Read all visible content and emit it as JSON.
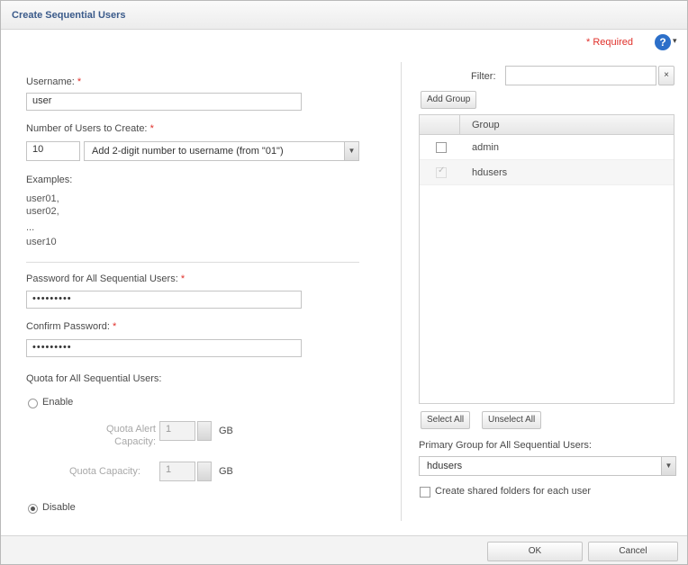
{
  "window": {
    "title": "Create Sequential Users"
  },
  "header": {
    "required_label": "* Required",
    "help_icon": "?",
    "help_caret": "▾"
  },
  "left": {
    "username_label": "Username:",
    "username_value": "user",
    "count_label": "Number of Users to Create:",
    "count_value": "10",
    "suffix_select": "Add 2-digit number to username (from \"01\")",
    "examples_label": "Examples:",
    "examples": [
      "user01,",
      "user02,",
      "...",
      "user10"
    ],
    "password_label": "Password for All Sequential Users:",
    "password_value": "•••••••••",
    "confirm_label": "Confirm Password:",
    "confirm_value": "•••••••••",
    "quota_label": "Quota for All Sequential Users:",
    "enable_label": "Enable",
    "alert_label_1": "Quota Alert",
    "alert_label_2": "Capacity:",
    "alert_value": "1",
    "alert_unit": "GB",
    "capacity_label": "Quota Capacity:",
    "capacity_value": "1",
    "capacity_unit": "GB",
    "disable_label": "Disable",
    "quota_mode": "Disable"
  },
  "right": {
    "filter_label": "Filter:",
    "filter_value": "",
    "filter_clear": "×",
    "add_group_label": "Add Group",
    "grid_header": "Group",
    "groups": [
      {
        "name": "admin",
        "checked": false
      },
      {
        "name": "hdusers",
        "checked": true
      }
    ],
    "select_all_label": "Select All",
    "unselect_all_label": "Unselect All",
    "primary_group_label": "Primary Group for All Sequential Users:",
    "primary_group_value": "hdusers",
    "create_folders_label": "Create shared folders for each user"
  },
  "footer": {
    "ok_label": "OK",
    "cancel_label": "Cancel"
  }
}
